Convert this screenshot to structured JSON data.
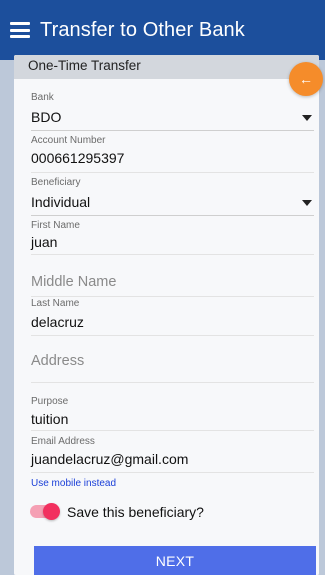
{
  "appbar": {
    "title": "Transfer to Other Bank",
    "menu_icon": "hamburger-menu-icon"
  },
  "card": {
    "header": "One-Time Transfer"
  },
  "fab": {
    "icon": "arrow-left-icon",
    "glyph": "←",
    "color": "#f58c2a"
  },
  "form": {
    "bank": {
      "label": "Bank",
      "value": "BDO"
    },
    "account_number": {
      "label": "Account Number",
      "value": "000661295397"
    },
    "beneficiary": {
      "label": "Beneficiary",
      "value": "Individual"
    },
    "first_name": {
      "label": "First Name",
      "value": "juan"
    },
    "middle_name": {
      "placeholder": "Middle Name"
    },
    "last_name": {
      "label": "Last Name",
      "value": "delacruz"
    },
    "address": {
      "placeholder": "Address"
    },
    "purpose": {
      "label": "Purpose",
      "value": "tuition"
    },
    "email": {
      "label": "Email Address",
      "value": "juandelacruz@gmail.com"
    }
  },
  "use_mobile_link": "Use mobile instead",
  "save_beneficiary": {
    "label": "Save this beneficiary?",
    "checked": true,
    "color": "#f2305f"
  },
  "next_button": {
    "label": "NEXT",
    "color": "#4f6ee8"
  },
  "colors": {
    "appbar": "#1c4f9c",
    "background": "#c9d3e3"
  }
}
